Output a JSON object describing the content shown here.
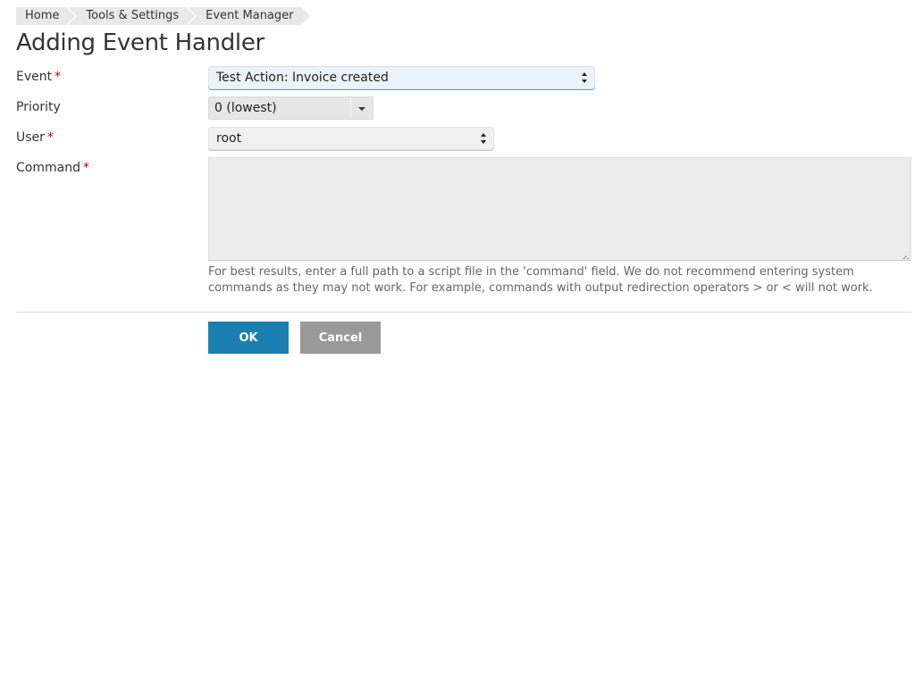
{
  "breadcrumb": {
    "items": [
      "Home",
      "Tools & Settings",
      "Event Manager"
    ]
  },
  "page": {
    "title": "Adding Event Handler"
  },
  "form": {
    "required_mark": "*",
    "event": {
      "label": "Event",
      "value": "Test Action: Invoice created"
    },
    "priority": {
      "label": "Priority",
      "value": "0 (lowest)"
    },
    "user": {
      "label": "User",
      "value": "root"
    },
    "command": {
      "label": "Command",
      "value": "",
      "hint": "For best results, enter a full path to a script file in the 'command' field. We do not recommend entering system commands as they may not work. For example, commands with output redirection operators > or < will not work."
    }
  },
  "buttons": {
    "ok_label": "OK",
    "cancel_label": "Cancel"
  },
  "colors": {
    "primary_button": "#1a7fb0",
    "secondary_button": "#999999",
    "required": "#c00000"
  }
}
